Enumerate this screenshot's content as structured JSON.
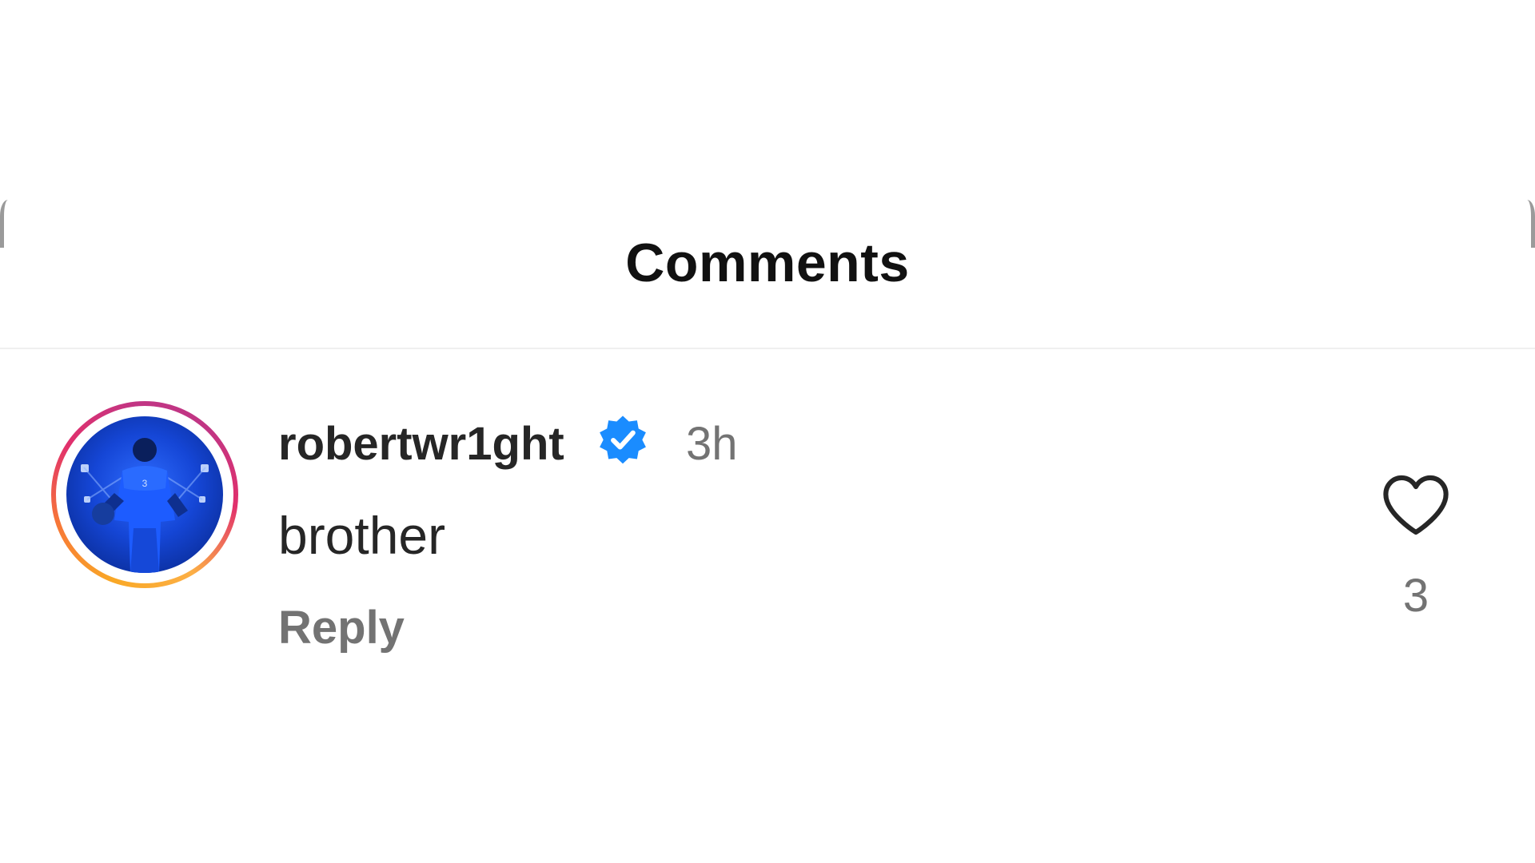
{
  "sheet": {
    "title": "Comments"
  },
  "comment": {
    "username": "robertwr1ght",
    "verified": true,
    "timestamp": "3h",
    "text": "brother",
    "reply_label": "Reply",
    "like_count": "3",
    "avatar_icon": "profile-photo-basketball-player",
    "like_icon": "heart-outline-icon",
    "verified_icon": "verified-badge-icon"
  },
  "colors": {
    "verified_blue": "#1a8cff",
    "secondary_text": "#737373",
    "primary_text": "#262626"
  }
}
